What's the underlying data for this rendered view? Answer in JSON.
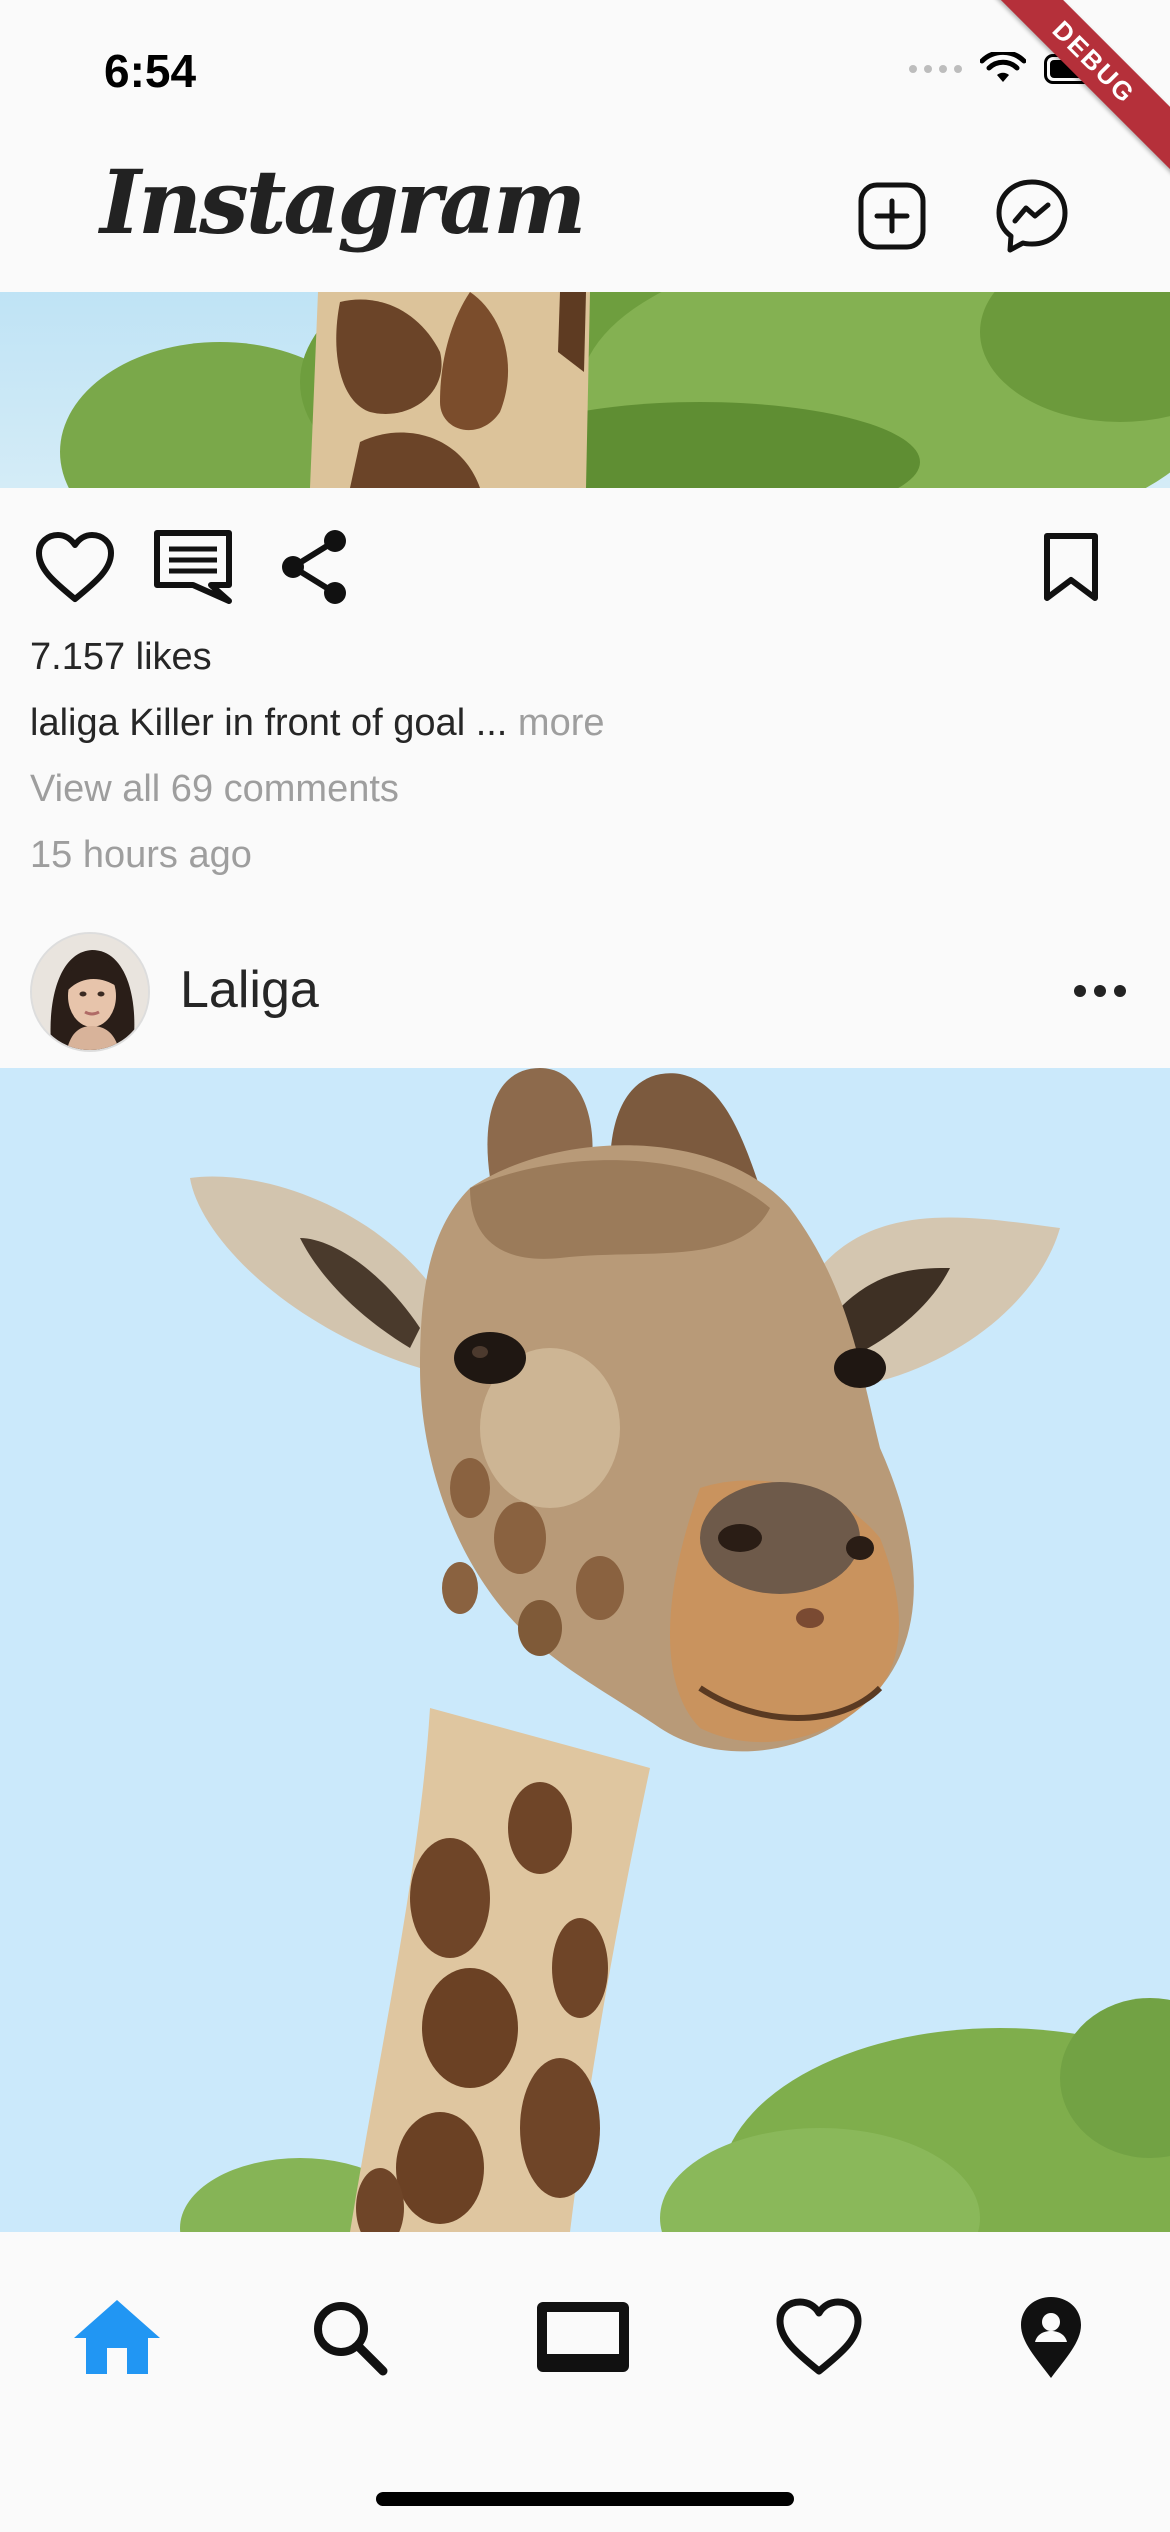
{
  "status_bar": {
    "time": "6:54"
  },
  "debug_banner": "DEBUG",
  "app_bar": {
    "logo": "Instagram",
    "add_post_icon": "add-square-icon",
    "messenger_icon": "messenger-icon"
  },
  "previous_post": {
    "likes": "7.157 likes",
    "caption_user": "laliga",
    "caption_text": " Killer in front of goal ...",
    "caption_more": " more",
    "view_comments": "View all 69 comments",
    "timestamp": "15 hours ago"
  },
  "post": {
    "username": "Laliga"
  },
  "bottom_nav": {
    "items": [
      {
        "icon": "home-icon",
        "active": true
      },
      {
        "icon": "search-icon",
        "active": false
      },
      {
        "icon": "reels-icon",
        "active": false
      },
      {
        "icon": "heart-icon",
        "active": false
      },
      {
        "icon": "location-pin-icon",
        "active": false
      }
    ],
    "active_color": "#2196f3"
  }
}
